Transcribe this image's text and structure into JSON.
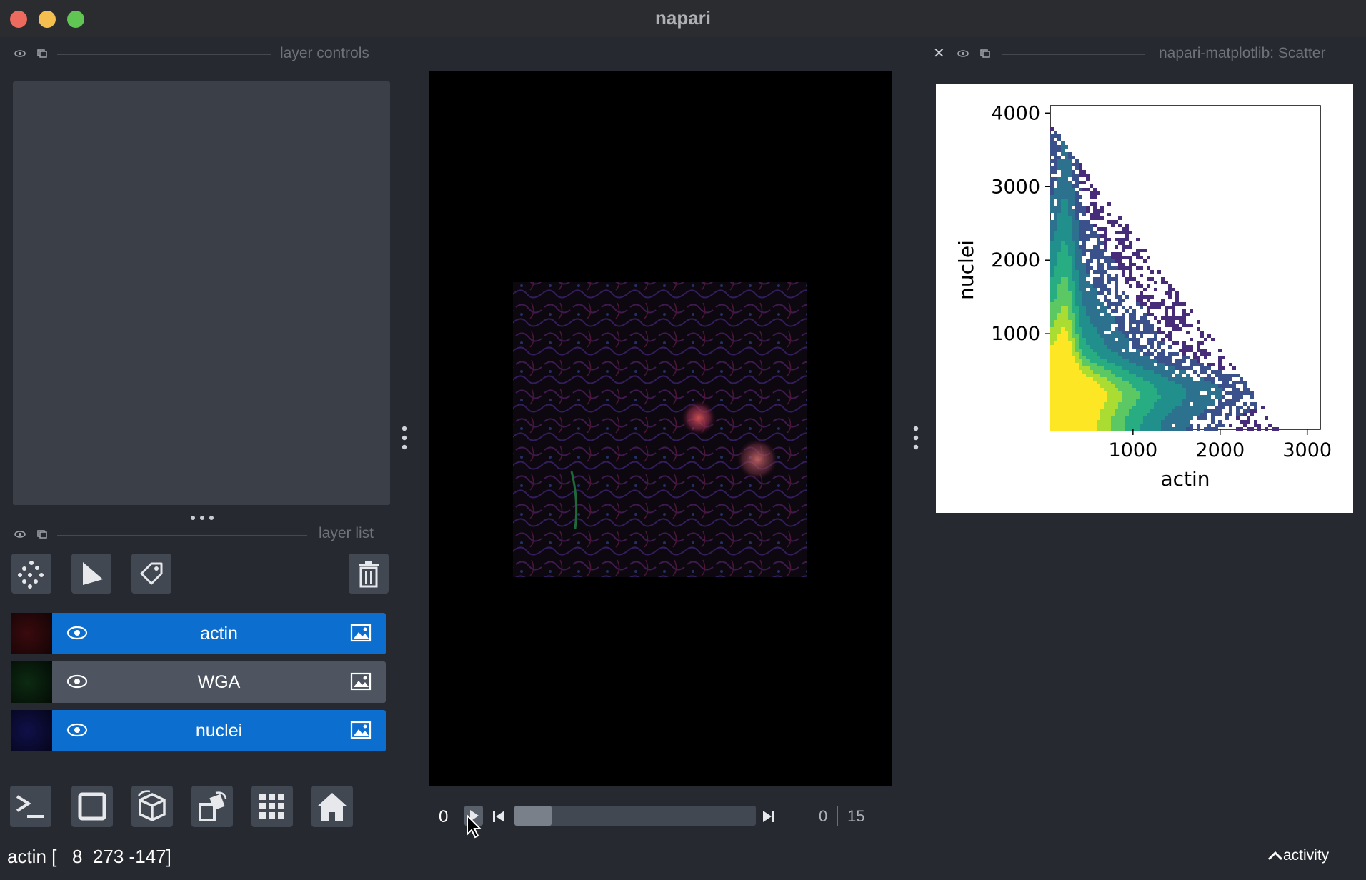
{
  "window": {
    "title": "napari"
  },
  "left_dock": {
    "controls_header": "layer controls",
    "list_header": "layer list",
    "tools": [
      {
        "name": "new-points-layer",
        "icon": "points-icon"
      },
      {
        "name": "new-shapes-layer",
        "icon": "shapes-icon"
      },
      {
        "name": "new-labels-layer",
        "icon": "labels-icon"
      },
      {
        "name": "delete-layer",
        "icon": "trash-icon"
      }
    ],
    "layers": [
      {
        "name": "actin",
        "visible": true,
        "selected": true,
        "color": "#cc2020"
      },
      {
        "name": "WGA",
        "visible": true,
        "selected": false,
        "color": "#20a040"
      },
      {
        "name": "nuclei",
        "visible": true,
        "selected": true,
        "color": "#2a2ad0"
      }
    ],
    "viewer_buttons": [
      {
        "name": "console",
        "icon": "console-icon"
      },
      {
        "name": "ndisplay",
        "icon": "square-icon"
      },
      {
        "name": "roll",
        "icon": "cube-icon"
      },
      {
        "name": "transpose",
        "icon": "transpose-icon"
      },
      {
        "name": "grid",
        "icon": "grid-icon"
      },
      {
        "name": "home",
        "icon": "home-icon"
      }
    ]
  },
  "slider": {
    "axis_label": "0",
    "current": "0",
    "total": "15",
    "value_fraction": 0.0
  },
  "right_dock": {
    "header": "napari-matplotlib: Scatter",
    "chart_data": {
      "type": "heatmap",
      "title": "",
      "xlabel": "actin",
      "ylabel": "nuclei",
      "xticks": [
        "1000",
        "2000",
        "3000"
      ],
      "yticks": [
        "1000",
        "2000",
        "3000",
        "4000"
      ],
      "xlim": [
        50,
        3150
      ],
      "ylim": [
        -300,
        4100
      ],
      "colormap": "viridis"
    }
  },
  "status": {
    "text": "actin [   8  273 -147]",
    "activity": "activity"
  },
  "colors": {
    "selected_layer": "#0c6fcf",
    "unselected_layer": "#4e5560",
    "panel_bg": "#262930"
  }
}
